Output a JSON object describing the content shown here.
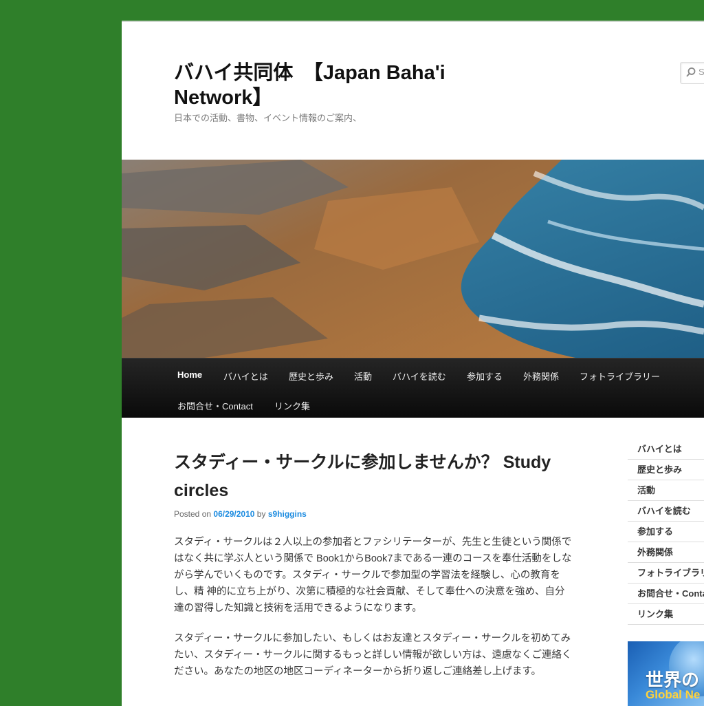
{
  "header": {
    "title": "バハイ共同体　【Japan Baha'i Network】",
    "description": "日本での活動、書物、イベント情報のご案内、",
    "search_placeholder": "S"
  },
  "nav": {
    "items": [
      "Home",
      "バハイとは",
      "歴史と歩み",
      "活動",
      "バハイを読む",
      "参加する",
      "外務関係",
      "フォトライブラリー",
      "お問合せ・Contact",
      "リンク集"
    ]
  },
  "post": {
    "title": "スタディー・サークルに参加しませんか？ Study circles",
    "posted_on_label": "Posted on",
    "date": "06/29/2010",
    "by_label": "by",
    "author": "s9higgins",
    "paragraphs": [
      "スタディ・サークルは２人以上の参加者とファシリテーターが、先生と生徒という関係ではなく共に学ぶ人という関係で Book1からBook7まである一連のコースを奉仕活動をしながら学んでいくものです。スタディ・サークルで参加型の学習法を経験し、心の教育をし、精 神的に立ち上がり、次第に積極的な社会貢献、そして奉仕への決意を強め、自分達の習得した知識と技術を活用できるようになります。",
      "スタディー・サークルに参加したい、もしくはお友達とスタディー・サークルを初めてみたい、スタディー・サークルに関するもっと詳しい情報が欲しい方は、遠慮なくご連絡ください。あなたの地区の地区コーディネーターから折り返しご連絡差し上げます。"
    ]
  },
  "sidebar": {
    "items": [
      "バハイとは",
      "歴史と歩み",
      "活動",
      "バハイを読む",
      "参加する",
      "外務関係",
      "フォトライブラリー",
      "お問合せ・Contact",
      "リンク集"
    ],
    "widget_text_1": "世界の",
    "widget_text_2": "Global Ne"
  },
  "colors": {
    "background": "#2f7f2a",
    "nav_bg": "#111111",
    "link": "#1b8be0"
  }
}
